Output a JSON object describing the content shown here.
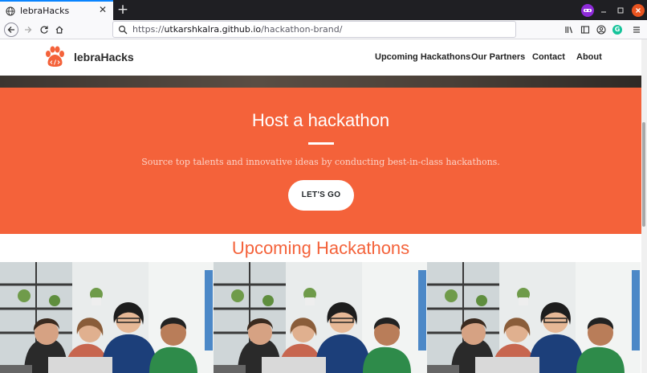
{
  "browser": {
    "tab_title": "lebraHacks",
    "tab_close": "✕",
    "new_tab": "+",
    "url_prefix": "https://",
    "url_host": "utkarshkalra.github.io",
    "url_path": "/hackathon-brand/"
  },
  "site": {
    "brand": "lebraHacks",
    "menu": [
      {
        "label": "Upcoming Hackathons"
      },
      {
        "label": "Our Partners"
      },
      {
        "label": "Contact"
      },
      {
        "label": "About"
      }
    ]
  },
  "hero": {
    "title": "Host a hackathon",
    "subtitle": "Source top talents and innovative ideas by conducting best-in-class hackathons.",
    "cta": "LET'S GO"
  },
  "upcoming": {
    "title": "Upcoming Hackathons",
    "photos": [
      {
        "alt": "team-working-photo"
      },
      {
        "alt": "team-working-photo"
      },
      {
        "alt": "team-working-photo"
      }
    ]
  },
  "colors": {
    "accent": "#f4623a",
    "chrome_dark": "#1f1f23"
  }
}
